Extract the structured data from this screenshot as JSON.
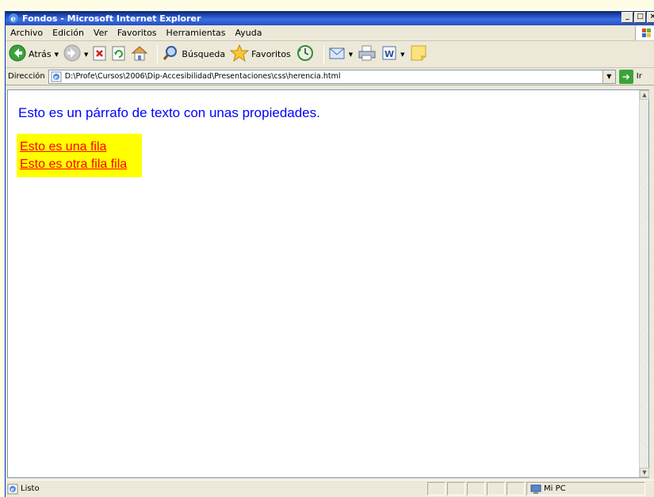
{
  "window": {
    "title": "Fondos - Microsoft Internet Explorer",
    "controls": {
      "minimize": "_",
      "maximize": "□",
      "close": "×"
    }
  },
  "menu": {
    "items": [
      "Archivo",
      "Edición",
      "Ver",
      "Favoritos",
      "Herramientas",
      "Ayuda"
    ]
  },
  "toolbar": {
    "back_label": "Atrás",
    "search_label": "Búsqueda",
    "favorites_label": "Favoritos",
    "icons": [
      "back-icon",
      "forward-icon",
      "stop-icon",
      "refresh-icon",
      "home-icon",
      "search-icon",
      "favorites-star-icon",
      "history-icon",
      "mail-icon",
      "print-icon",
      "word-edit-icon",
      "notes-icon"
    ]
  },
  "address": {
    "label": "Dirección",
    "value": "D:\\Profe\\Cursos\\2006\\Dip-Accesibilidad\\Presentaciones\\css\\herencia.html",
    "go_label": "Ir"
  },
  "page": {
    "paragraph": "Esto es un párrafo de texto con unas propiedades.",
    "rows": [
      "Esto es una fila",
      "Esto es otra fila fila"
    ],
    "colors": {
      "paragraph_text": "#0000ff",
      "rows_text": "#ff0000",
      "rows_background": "#ffff00"
    }
  },
  "status": {
    "text": "Listo",
    "zone": "Mi PC"
  }
}
